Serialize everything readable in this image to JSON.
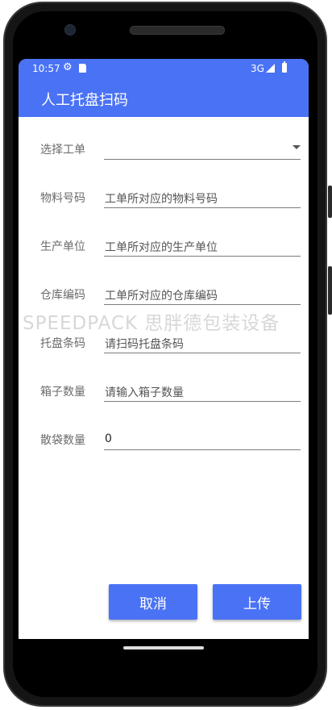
{
  "status_bar": {
    "time": "10:57",
    "network": "3G",
    "settings_icon": "gear-icon",
    "sd_icon": "sd-card-icon",
    "signal_icon": "signal-icon",
    "battery_icon": "battery-icon"
  },
  "app_bar": {
    "title": "人工托盘扫码"
  },
  "form": {
    "work_order": {
      "label": "选择工单",
      "value": ""
    },
    "material_code": {
      "label": "物料号码",
      "placeholder": "工单所对应的物料号码"
    },
    "production_unit": {
      "label": "生产单位",
      "placeholder": "工单所对应的生产单位"
    },
    "warehouse_code": {
      "label": "仓库编码",
      "placeholder": "工单所对应的仓库编码"
    },
    "pallet_barcode": {
      "label": "托盘条码",
      "placeholder": "请扫码托盘条码"
    },
    "box_quantity": {
      "label": "箱子数量",
      "placeholder": "请输入箱子数量"
    },
    "loose_bag_quantity": {
      "label": "散袋数量",
      "value": "0"
    }
  },
  "watermark": "SPEEDPACK 思胖德包装设备",
  "buttons": {
    "cancel": "取消",
    "upload": "上传"
  },
  "colors": {
    "accent": "#4a72f5"
  }
}
